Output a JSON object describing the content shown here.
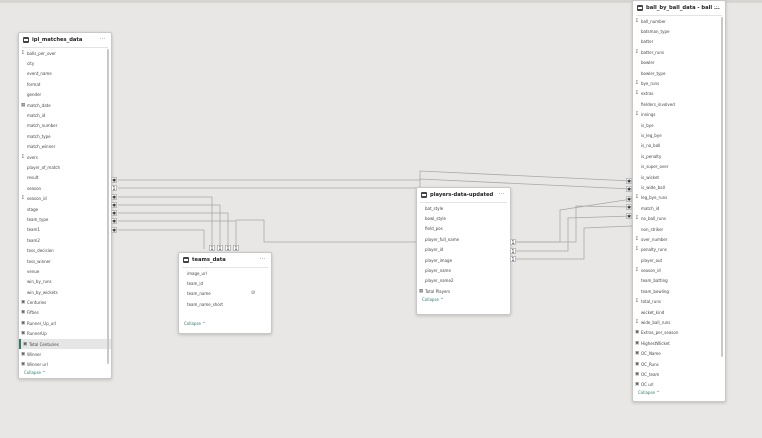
{
  "ipl": {
    "title": "ipl_matches_data",
    "fields": [
      {
        "icon": "Σ",
        "label": "balls_per_over"
      },
      {
        "icon": "",
        "label": "city"
      },
      {
        "icon": "",
        "label": "event_name"
      },
      {
        "icon": "",
        "label": "format"
      },
      {
        "icon": "",
        "label": "gender"
      },
      {
        "icon": "▦",
        "label": "match_date"
      },
      {
        "icon": "",
        "label": "match_id"
      },
      {
        "icon": "",
        "label": "match_number"
      },
      {
        "icon": "",
        "label": "match_type"
      },
      {
        "icon": "",
        "label": "match_winner"
      },
      {
        "icon": "Σ",
        "label": "overs"
      },
      {
        "icon": "",
        "label": "player_of_match"
      },
      {
        "icon": "",
        "label": "result"
      },
      {
        "icon": "",
        "label": "season"
      },
      {
        "icon": "Σ",
        "label": "season_id"
      },
      {
        "icon": "",
        "label": "stage"
      },
      {
        "icon": "",
        "label": "team_type"
      },
      {
        "icon": "",
        "label": "team1"
      },
      {
        "icon": "",
        "label": "team2"
      },
      {
        "icon": "",
        "label": "toss_decision"
      },
      {
        "icon": "",
        "label": "toss_winner"
      },
      {
        "icon": "",
        "label": "venue"
      },
      {
        "icon": "",
        "label": "win_by_runs"
      },
      {
        "icon": "",
        "label": "win_by_wickets"
      },
      {
        "icon": "▣",
        "label": "Centuries"
      },
      {
        "icon": "▣",
        "label": "Fifties"
      },
      {
        "icon": "▣",
        "label": "Runner_Up_url"
      },
      {
        "icon": "▣",
        "label": "RunnerUp"
      },
      {
        "icon": "▣",
        "label": "Total Centuries"
      },
      {
        "icon": "▣",
        "label": "Winner"
      },
      {
        "icon": "▣",
        "label": "Winner url"
      }
    ],
    "collapse": "Collapse ^"
  },
  "teams": {
    "title": "teams_data",
    "fields": [
      {
        "icon": "",
        "label": "image_url"
      },
      {
        "icon": "",
        "label": "team_id"
      },
      {
        "icon": "",
        "label": "team_name"
      },
      {
        "icon": "",
        "label": "team_name_short"
      }
    ],
    "collapse": "Collapse ^"
  },
  "players": {
    "title": "players-data-updated",
    "fields": [
      {
        "icon": "",
        "label": "bat_style"
      },
      {
        "icon": "",
        "label": "bowl_style"
      },
      {
        "icon": "",
        "label": "field_pos"
      },
      {
        "icon": "",
        "label": "player_full_name"
      },
      {
        "icon": "",
        "label": "player_id"
      },
      {
        "icon": "",
        "label": "player_image"
      },
      {
        "icon": "",
        "label": "player_name"
      },
      {
        "icon": "",
        "label": "player_name2"
      },
      {
        "icon": "▦",
        "label": "Total Players"
      }
    ],
    "collapse": "Collapse ^"
  },
  "ball": {
    "title": "ball_by_ball_data - ball ...",
    "fields": [
      {
        "icon": "Σ",
        "label": "ball_number"
      },
      {
        "icon": "",
        "label": "batsman_type"
      },
      {
        "icon": "",
        "label": "batter"
      },
      {
        "icon": "Σ",
        "label": "batter_runs"
      },
      {
        "icon": "",
        "label": "bowler"
      },
      {
        "icon": "",
        "label": "bowler_type"
      },
      {
        "icon": "Σ",
        "label": "bye_runs"
      },
      {
        "icon": "Σ",
        "label": "extras"
      },
      {
        "icon": "",
        "label": "fielders_involved"
      },
      {
        "icon": "Σ",
        "label": "innings"
      },
      {
        "icon": "",
        "label": "is_bye"
      },
      {
        "icon": "",
        "label": "is_leg_bye"
      },
      {
        "icon": "",
        "label": "is_no_ball"
      },
      {
        "icon": "",
        "label": "is_penalty"
      },
      {
        "icon": "",
        "label": "is_super_over"
      },
      {
        "icon": "",
        "label": "is_wicket"
      },
      {
        "icon": "",
        "label": "is_wide_ball"
      },
      {
        "icon": "Σ",
        "label": "leg_bye_runs"
      },
      {
        "icon": "",
        "label": "match_id"
      },
      {
        "icon": "Σ",
        "label": "no_ball_runs"
      },
      {
        "icon": "",
        "label": "non_striker"
      },
      {
        "icon": "Σ",
        "label": "over_number"
      },
      {
        "icon": "Σ",
        "label": "penalty_runs"
      },
      {
        "icon": "",
        "label": "player_out"
      },
      {
        "icon": "Σ",
        "label": "season_id"
      },
      {
        "icon": "",
        "label": "team_batting"
      },
      {
        "icon": "",
        "label": "team_bowling"
      },
      {
        "icon": "Σ",
        "label": "total_runs"
      },
      {
        "icon": "",
        "label": "wicket_kind"
      },
      {
        "icon": "Σ",
        "label": "wide_ball_runs"
      },
      {
        "icon": "▣",
        "label": "Extras_per_season"
      },
      {
        "icon": "▣",
        "label": "HighestWicket"
      },
      {
        "icon": "▣",
        "label": "OC_Name"
      },
      {
        "icon": "▣",
        "label": "OC_Runs"
      },
      {
        "icon": "▣",
        "label": "OC_team"
      },
      {
        "icon": "▣",
        "label": "OC url"
      }
    ],
    "collapse": "Collapse ^"
  },
  "markers": {
    "many": "✱",
    "one": "1"
  },
  "colors": {
    "accent": "#2d7d6f",
    "canvas": "#e8e7e5",
    "line": "#a9a8a6"
  }
}
